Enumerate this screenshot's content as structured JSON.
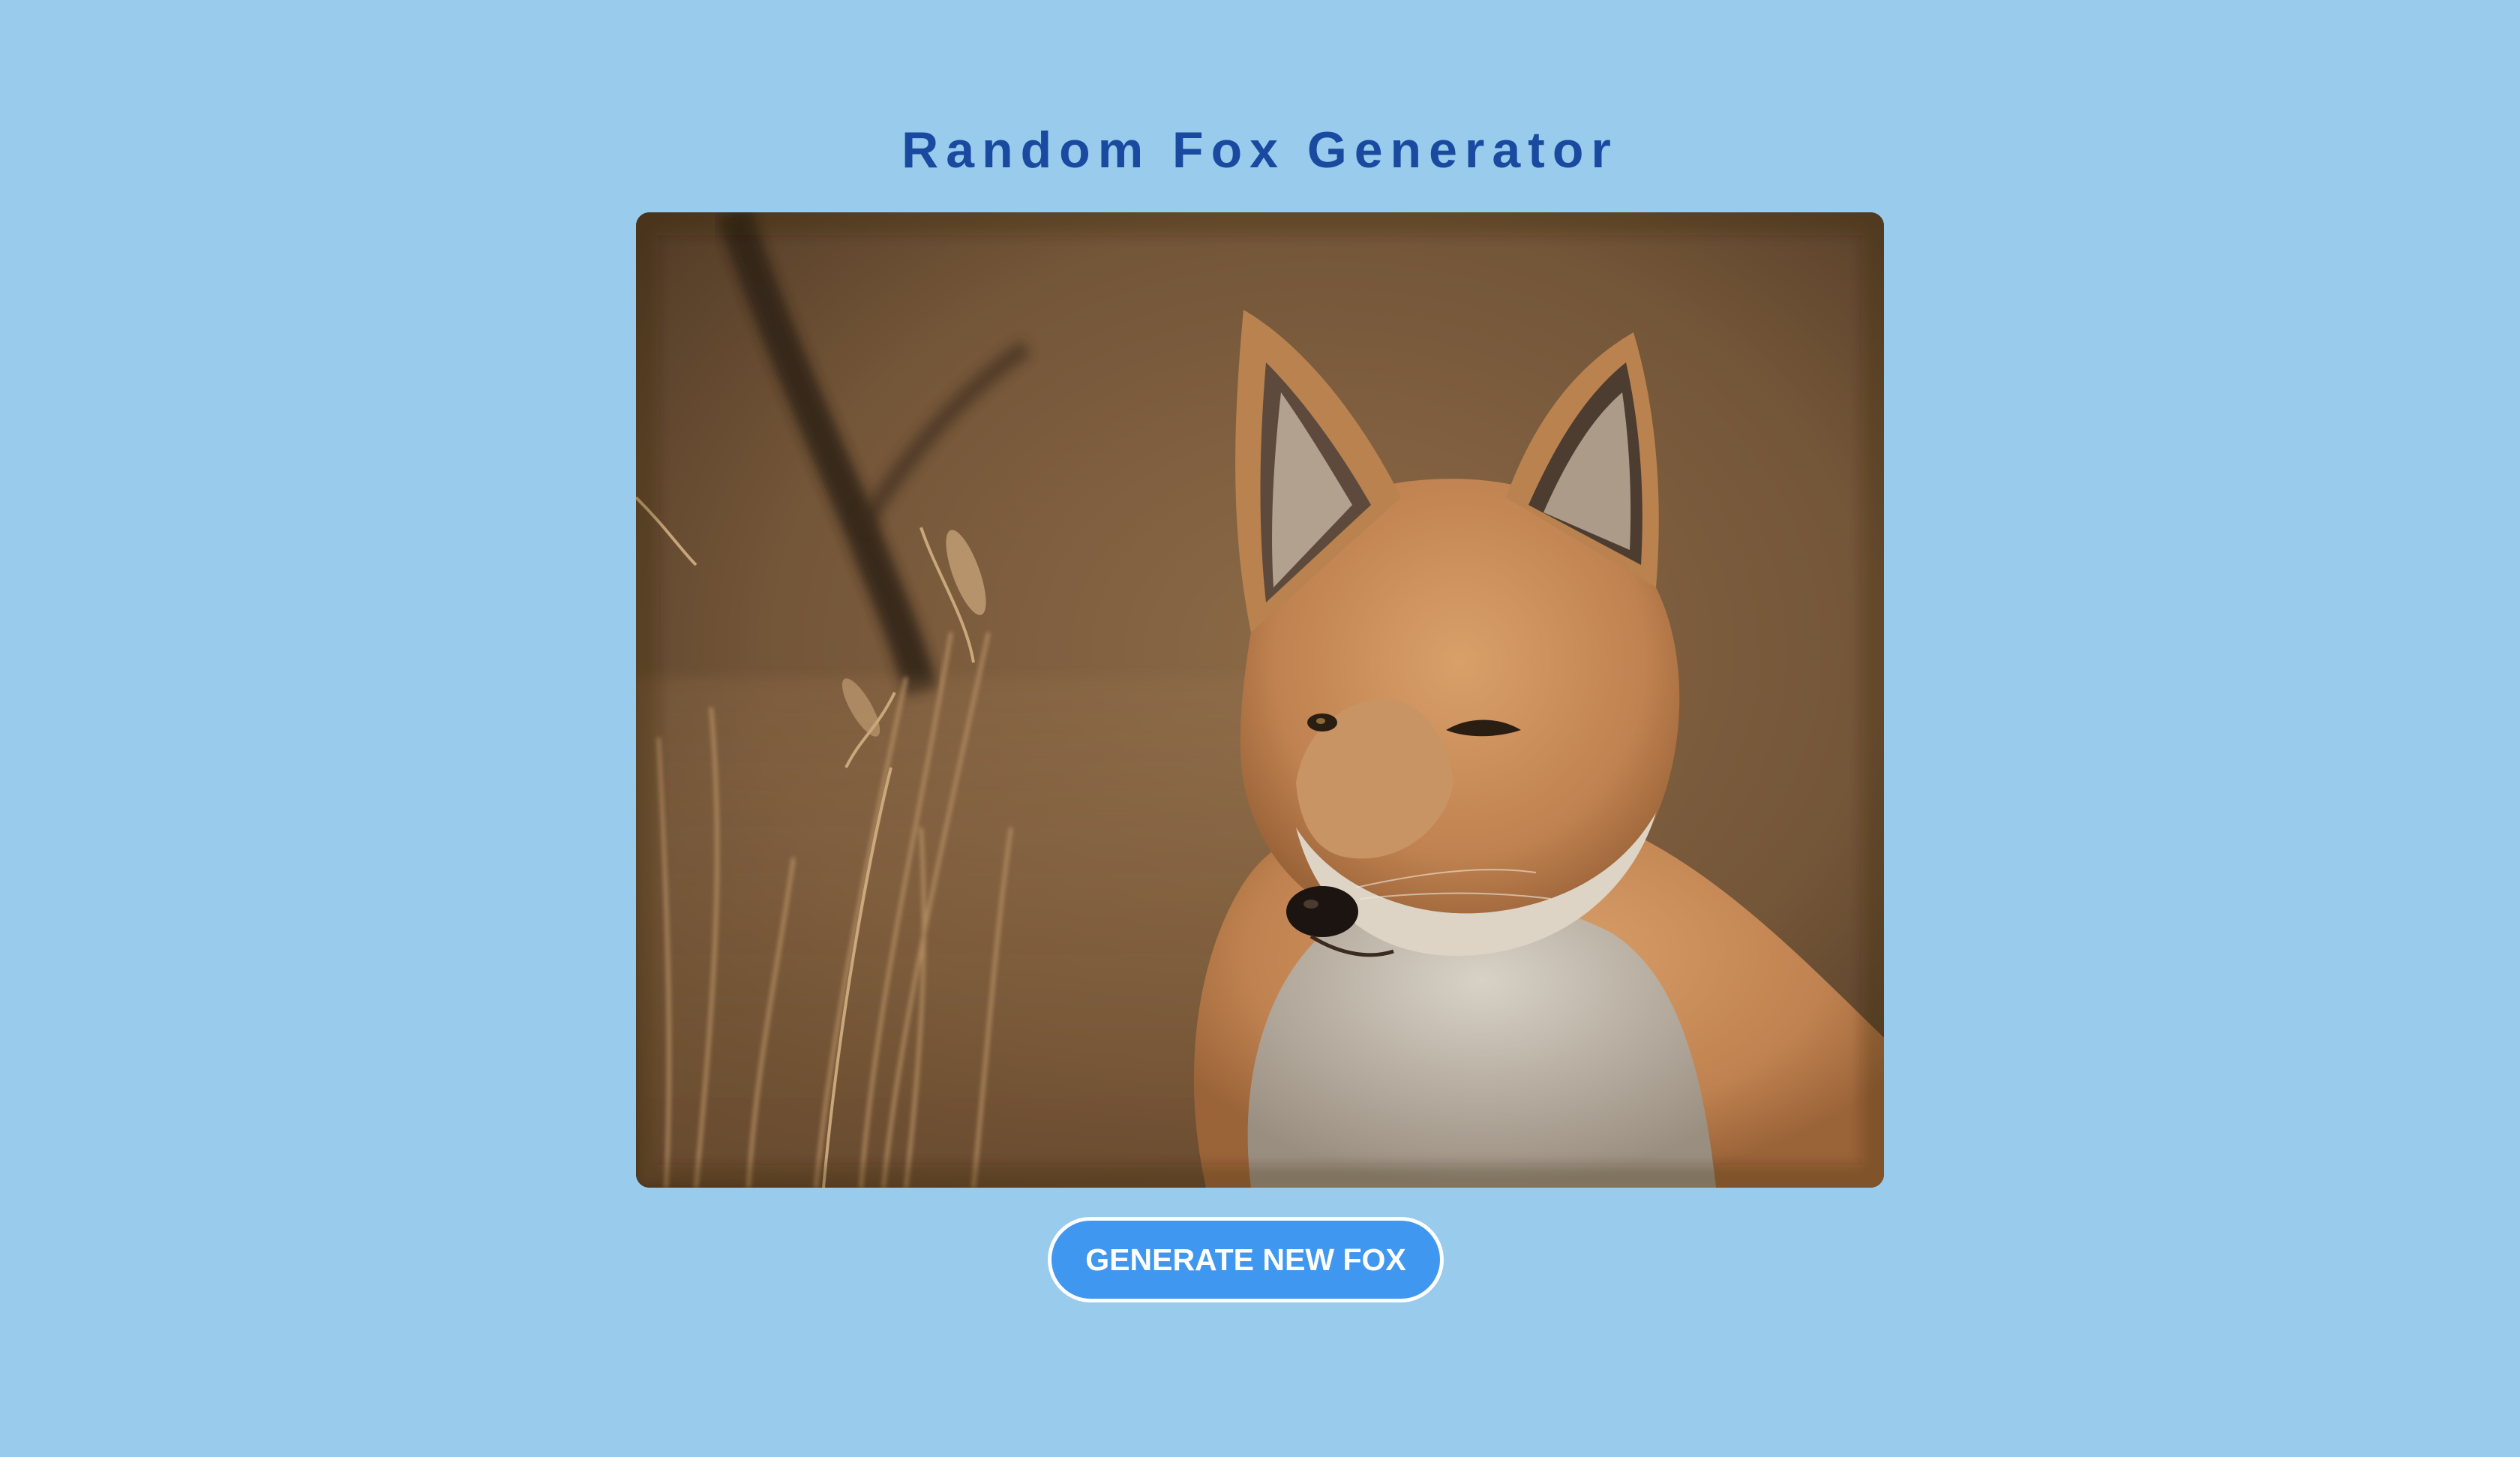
{
  "app": {
    "title": "Random Fox Generator"
  },
  "image": {
    "subject": "red fox sitting in dry grass",
    "icon": "fox-photo"
  },
  "actions": {
    "generate_label": "GENERATE NEW FOX"
  },
  "colors": {
    "background": "#98cbec",
    "title": "#1a4aa0",
    "button": "#3f97ef",
    "button_text": "#ffffff",
    "button_border": "#ffffff"
  }
}
